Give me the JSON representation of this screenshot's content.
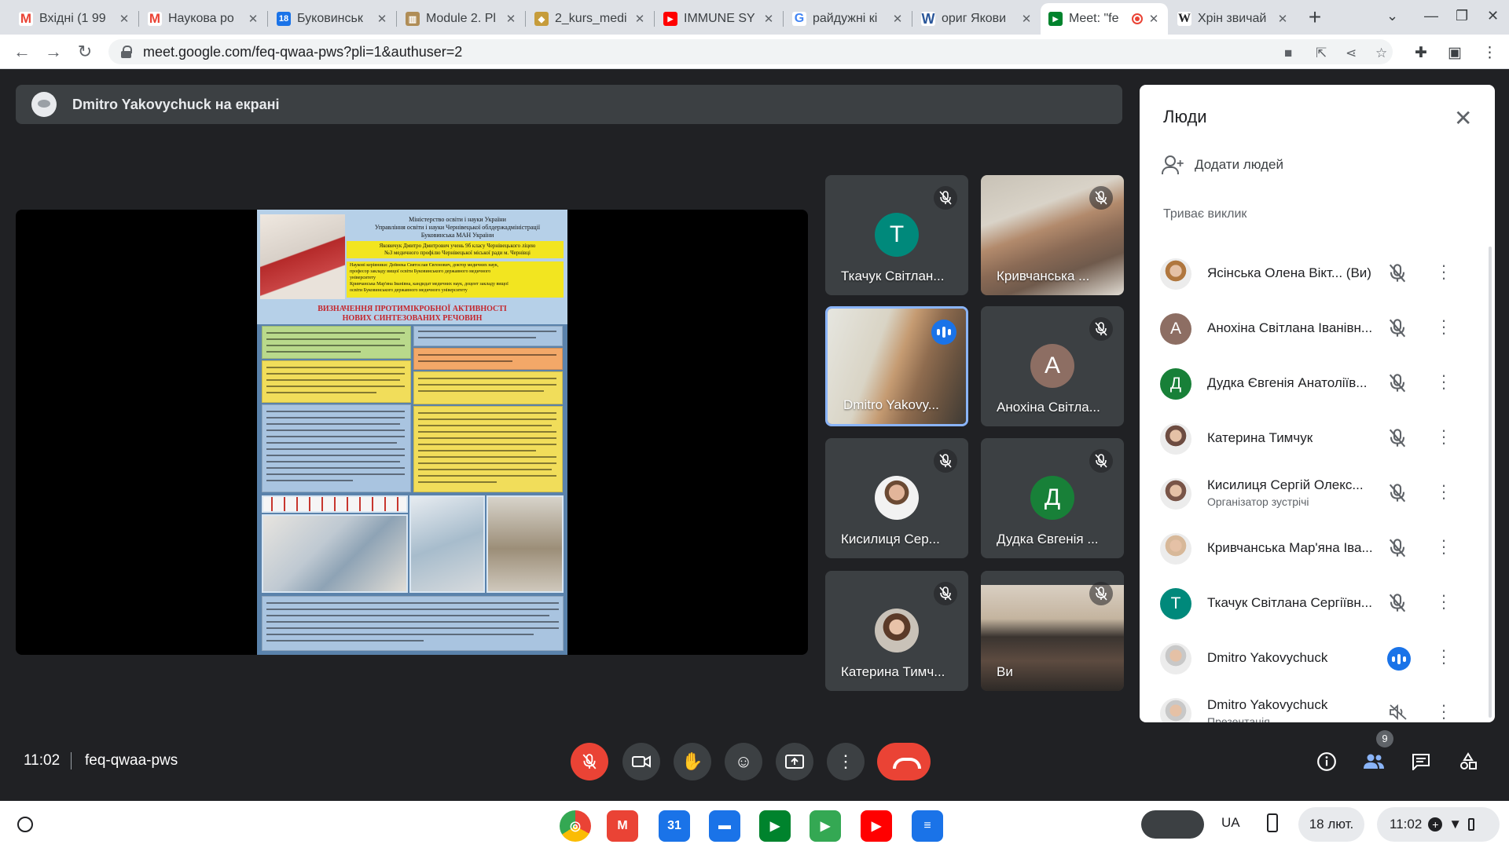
{
  "browser": {
    "tabs": [
      {
        "title": "Вхідні (1 99",
        "favicon": "gmail-icon",
        "color": "#ea4335",
        "letter": "M"
      },
      {
        "title": "Наукова ро",
        "favicon": "gmail-icon",
        "color": "#ea4335",
        "letter": "M"
      },
      {
        "title": "Буковинськ",
        "favicon": "calendar-icon",
        "color": "#1a73e8",
        "letter": "18"
      },
      {
        "title": "Module 2. Pl",
        "favicon": "book-icon",
        "color": "#b08d57",
        "letter": "▥"
      },
      {
        "title": "2_kurs_medi",
        "favicon": "shield-icon",
        "color": "#c69c3b",
        "letter": "◆"
      },
      {
        "title": "IMMUNE SY",
        "favicon": "youtube-icon",
        "color": "#ff0000",
        "letter": "▶"
      },
      {
        "title": "райдужні кі",
        "favicon": "google-icon",
        "color": "#4285f4",
        "letter": "G"
      },
      {
        "title": "ориг Якови",
        "favicon": "word-icon",
        "color": "#2b579a",
        "letter": "W"
      },
      {
        "title": "Meet: \"fe",
        "favicon": "meet-icon",
        "color": "#00832d",
        "letter": "▶",
        "active": true
      },
      {
        "title": "Хрін звичай",
        "favicon": "wikipedia-icon",
        "color": "#ffffff",
        "letter": "W"
      }
    ],
    "url": "meet.google.com/feq-qwaa-pws?pli=1&authuser=2"
  },
  "meet": {
    "presenter_text": "Dmitro Yakovychuck на екрані",
    "meeting_time": "11:02",
    "meeting_code": "feq-qwaa-pws",
    "people_count": "9"
  },
  "poster": {
    "header_lines": [
      "Міністерство освіти і науки України",
      "Управління освіти і науки Чернівецької облдержадміністрації",
      "Буковинська МАН України"
    ],
    "author_lines": [
      "Яковичук Дмитро Дмитрович учень 9б класу Чернівецького ліцею",
      "№3 медичного профілю Чернівецької міської ради м. Чернівці"
    ],
    "advisor_lines": [
      "Наукові керівники: Дейнека Святослав Євгенович, доктор медичних наук,",
      "професор закладу вищої освіти Буковинського державного медичного",
      "університету",
      "Кривчанська Мар'яна Іванівна, кандидат медичних наук, доцент закладу вищої",
      "освіти Буковинського державного медичного університету"
    ],
    "title_lines": [
      "ВИЗНАЧЕННЯ ПРОТИМІКРОБНОЇ АКТИВНОСТІ",
      "НОВИХ СИНТЕЗОВАНИХ РЕЧОВИН"
    ]
  },
  "tiles": [
    {
      "name": "Ткачук Світлан...",
      "type": "letter",
      "letter": "Т",
      "color": "#00897b",
      "mic": "off"
    },
    {
      "name": "Кривчанська ...",
      "type": "video",
      "mic": "off"
    },
    {
      "name": "Dmitro Yakovy...",
      "type": "video",
      "mic": "on"
    },
    {
      "name": "Анохіна Світла...",
      "type": "letter",
      "letter": "А",
      "color": "#8d6e63",
      "mic": "off"
    },
    {
      "name": "Кисилиця Сер...",
      "type": "photo",
      "mic": "off"
    },
    {
      "name": "Дудка Євгенія ...",
      "type": "letter",
      "letter": "Д",
      "color": "#188038",
      "mic": "off"
    },
    {
      "name": "Катерина Тимч...",
      "type": "photo",
      "mic": "off"
    },
    {
      "name": "Ви",
      "type": "video",
      "mic": "off"
    }
  ],
  "people_panel": {
    "title": "Люди",
    "add_people": "Додати людей",
    "section": "Триває виклик",
    "people": [
      {
        "name": "Ясінська Олена Вікт... (Ви)",
        "subtitle": "",
        "avatar": "photo",
        "color": "#b0773f",
        "letter": "",
        "mic": "off"
      },
      {
        "name": "Анохіна Світлана Іванівн...",
        "subtitle": "",
        "avatar": "letter",
        "color": "#8d6e63",
        "letter": "А",
        "mic": "off"
      },
      {
        "name": "Дудка Євгенія Анатоліїв...",
        "subtitle": "",
        "avatar": "letter",
        "color": "#188038",
        "letter": "Д",
        "mic": "off"
      },
      {
        "name": "Катерина Тимчук",
        "subtitle": "",
        "avatar": "photo",
        "color": "#6d4c41",
        "letter": "",
        "mic": "off"
      },
      {
        "name": "Кисилиця Сергій Олекс...",
        "subtitle": "Організатор зустрічі",
        "avatar": "photo",
        "color": "#795548",
        "letter": "",
        "mic": "off"
      },
      {
        "name": "Кривчанська Мар'яна Іва...",
        "subtitle": "",
        "avatar": "photo",
        "color": "#d7b899",
        "letter": "",
        "mic": "off"
      },
      {
        "name": "Ткачук Світлана Сергіївн...",
        "subtitle": "",
        "avatar": "letter",
        "color": "#00897b",
        "letter": "Т",
        "mic": "off"
      },
      {
        "name": "Dmitro Yakovychuck",
        "subtitle": "",
        "avatar": "photo",
        "color": "#c8c8c8",
        "letter": "",
        "mic": "on"
      },
      {
        "name": "Dmitro Yakovychuck",
        "subtitle": "Презентація",
        "avatar": "photo",
        "color": "#c8c8c8",
        "letter": "",
        "mic": "presenting"
      }
    ]
  },
  "shelf": {
    "lang": "UA",
    "date": "18 лют.",
    "time": "11:02",
    "apps": [
      {
        "name": "chrome-icon",
        "color": "#4285f4",
        "label": "◎"
      },
      {
        "name": "gmail-app-icon",
        "color": "#ea4335",
        "label": "M"
      },
      {
        "name": "calendar-app-icon",
        "color": "#1a73e8",
        "label": "31"
      },
      {
        "name": "files-app-icon",
        "color": "#1a73e8",
        "label": "▬"
      },
      {
        "name": "meet-app-icon",
        "color": "#00832d",
        "label": "▶"
      },
      {
        "name": "play-store-icon",
        "color": "#34a853",
        "label": "▶"
      },
      {
        "name": "youtube-app-icon",
        "color": "#ff0000",
        "label": "▶"
      },
      {
        "name": "messages-app-icon",
        "color": "#1a73e8",
        "label": "≡"
      }
    ]
  }
}
